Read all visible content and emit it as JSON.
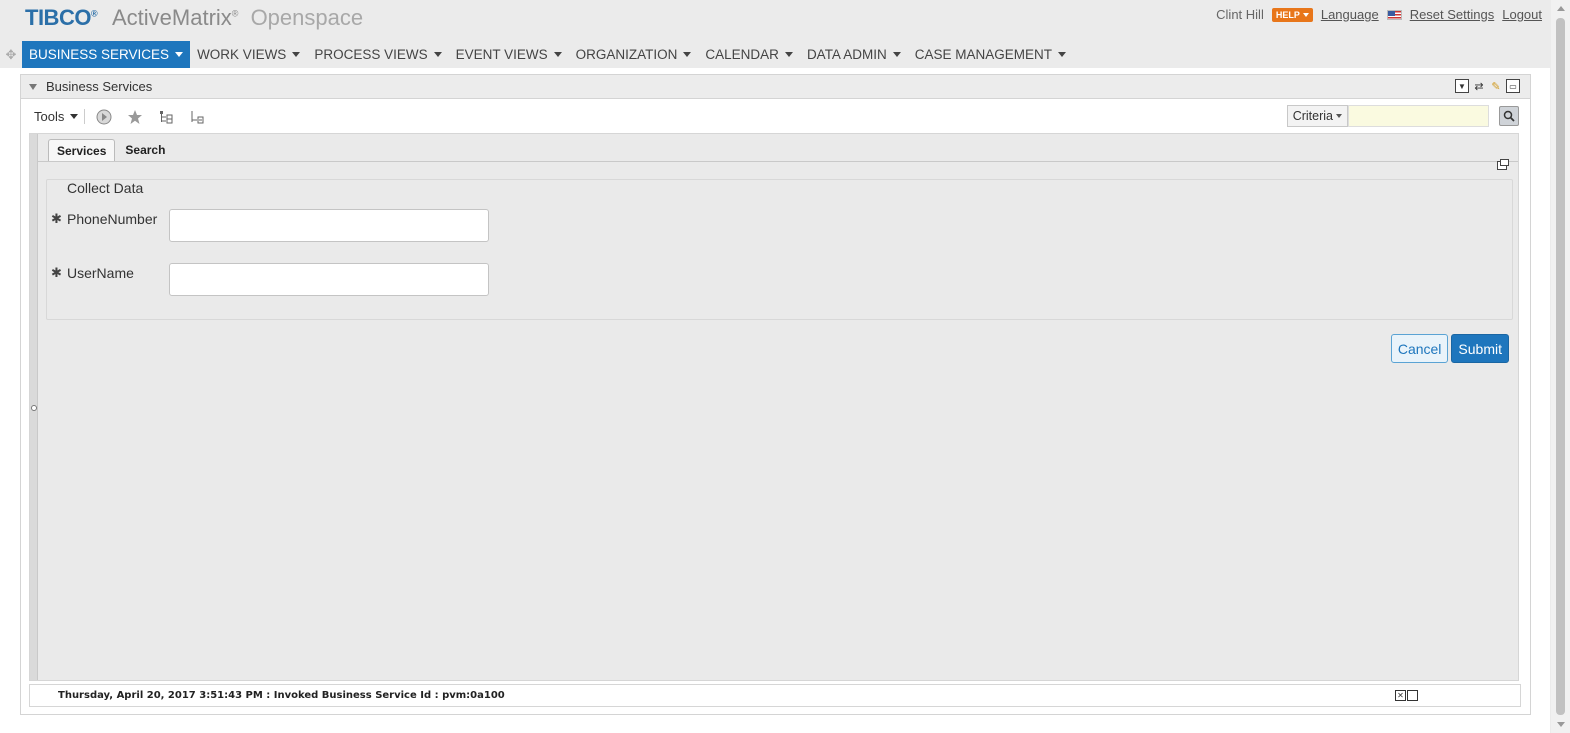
{
  "header": {
    "logo": "TIBCO",
    "logo_mark": "®",
    "product": "ActiveMatrix",
    "product_mark": "®",
    "module": "Openspace",
    "user": "Clint Hill",
    "help": "HELP",
    "language": "Language",
    "reset": "Reset Settings",
    "logout": "Logout"
  },
  "nav": [
    {
      "label": "BUSINESS SERVICES",
      "active": true
    },
    {
      "label": "WORK VIEWS"
    },
    {
      "label": "PROCESS VIEWS"
    },
    {
      "label": "EVENT VIEWS"
    },
    {
      "label": "ORGANIZATION"
    },
    {
      "label": "CALENDAR"
    },
    {
      "label": "DATA ADMIN"
    },
    {
      "label": "CASE MANAGEMENT"
    }
  ],
  "panel": {
    "title": "Business Services",
    "tools": "Tools",
    "criteria": "Criteria",
    "search_value": "",
    "tabs": [
      "Services",
      "Search"
    ],
    "form": {
      "legend": "Collect Data",
      "required_marker": "✱",
      "fields": [
        {
          "label": "PhoneNumber",
          "value": ""
        },
        {
          "label": "UserName",
          "value": ""
        }
      ],
      "cancel": "Cancel",
      "submit": "Submit"
    },
    "status": "Thursday, April 20, 2017 3:51:43 PM : Invoked Business Service Id : pvm:0a100"
  },
  "colors": {
    "accent": "#1e76bd",
    "help_badge": "#e8761a",
    "logo": "#2b6fa8"
  }
}
